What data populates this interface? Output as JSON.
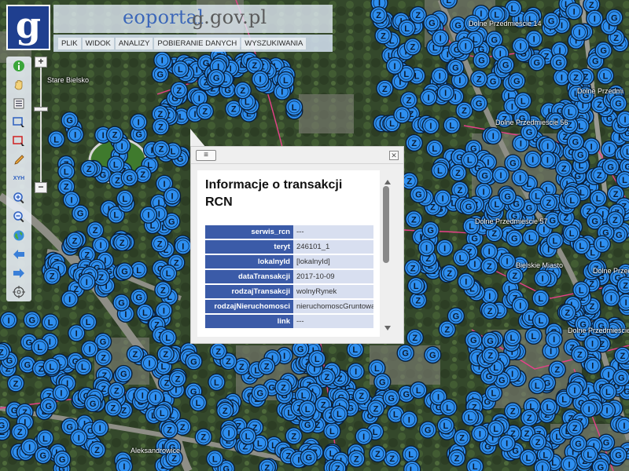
{
  "header": {
    "logo_letter": "g",
    "brand_prefix": "g",
    "brand_accent": "eoportal",
    "brand_suffix": ".gov.pl",
    "menu": [
      "PLIK",
      "WIDOK",
      "ANALIZY",
      "POBIERANIE DANYCH",
      "WYSZUKIWANIA"
    ]
  },
  "toolbar": {
    "tools": [
      "info-icon",
      "hand-pan-icon",
      "layers-icon",
      "select-icon",
      "select-remove-icon",
      "pencil-icon",
      "xyh-coordinates-icon",
      "zoom-in-icon",
      "zoom-out-icon",
      "globe-icon",
      "back-arrow-icon",
      "forward-arrow-icon",
      "target-icon"
    ],
    "xyh_label": "XYH",
    "zoom_in": "+",
    "zoom_out": "−"
  },
  "map": {
    "places": [
      "Stare Bielsko",
      "Dolne Przedmieście 14",
      "Dolne Przedmi",
      "Dolne Przedmieście 56",
      "Dolne Przedmieście 57",
      "Bielskie Miasto",
      "Dolne Przedm",
      "Dolne Przedmieście",
      "Aleksandrowice"
    ],
    "marker_letters": [
      "I",
      "L",
      "Z",
      "G"
    ],
    "colors": {
      "marker_fill": "#2e8ff0",
      "marker_stroke": "#0a1f3a",
      "boundary": "#e8408a"
    }
  },
  "popup": {
    "menu_icon": "≡",
    "close_icon": "✕",
    "title": "Informacje o transakcji RCN",
    "rows": [
      {
        "key": "serwis_rcn",
        "value": "---"
      },
      {
        "key": "teryt",
        "value": "246101_1"
      },
      {
        "key": "lokalnyId",
        "value": "[lokalnyId]"
      },
      {
        "key": "dataTransakcji",
        "value": "2017-10-09"
      },
      {
        "key": "rodzajTransakcji",
        "value": "wolnyRynek"
      },
      {
        "key": "rodzajNieruchomosci",
        "value": "nieruchomoscGruntowa"
      },
      {
        "key": "link",
        "value": "---"
      }
    ]
  }
}
